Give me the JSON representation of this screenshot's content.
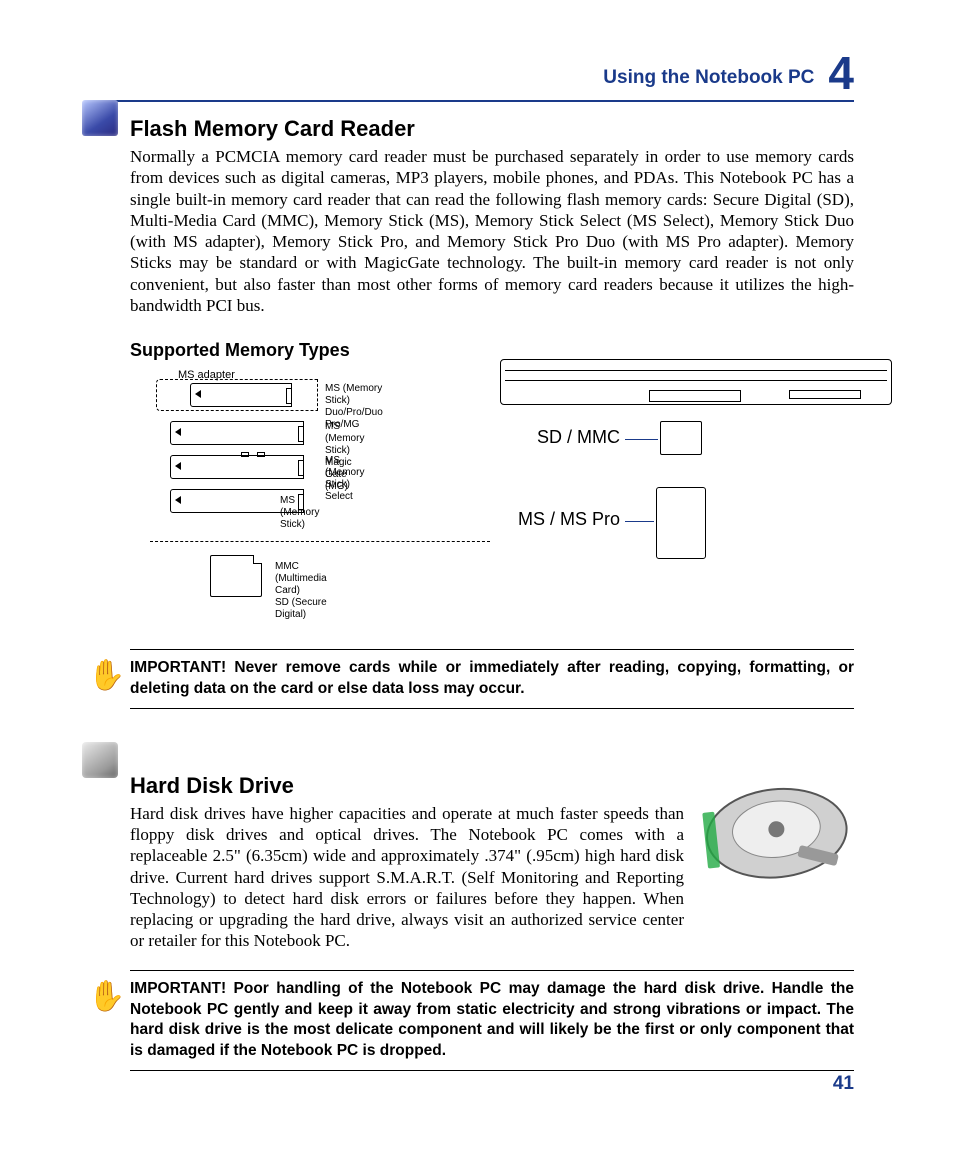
{
  "header": {
    "title": "Using the Notebook PC",
    "chapter": "4"
  },
  "section1": {
    "title": "Flash Memory Card Reader",
    "body": "Normally a PCMCIA memory card reader must be purchased separately in order to use memory cards from devices such as digital cameras, MP3 players, mobile phones, and PDAs. This Notebook PC has a single built-in memory card reader that can read the following flash memory cards: Secure Digital (SD), Multi-Media Card (MMC), Memory Stick (MS), Memory Stick Select (MS Select), Memory Stick Duo (with MS adapter), Memory Stick Pro, and Memory Stick Pro Duo (with MS Pro adapter). Memory Sticks may be standard or with MagicGate technology. The built-in memory card reader is not only convenient, but also faster than most other forms of memory card readers because it utilizes the high-bandwidth PCI bus."
  },
  "subsection": {
    "title": "Supported Memory Types"
  },
  "memtypes": {
    "adapter_label": "MS adapter",
    "rows": [
      {
        "label": "MS (Memory Stick)\nDuo/Pro/Duo Pro/MG"
      },
      {
        "label": "MS (Memory Stick)\nMagic Gate (MG)"
      },
      {
        "label": "MS (Memory Stick)\nSelect"
      },
      {
        "label": "MS (Memory Stick)"
      }
    ],
    "mmc_label": "MMC (Multimedia Card)\nSD (Secure Digital)",
    "sd_label": "SD / MMC",
    "ms_label": "MS / MS Pro"
  },
  "note1": {
    "label": "IMPORTANT!",
    "text": "  Never remove cards while or immediately after reading, copying, formatting, or deleting data on the card or else data loss may occur."
  },
  "section2": {
    "title": "Hard Disk Drive",
    "body": "Hard disk drives have higher capacities and operate at much faster speeds than floppy disk drives and optical drives. The Notebook PC comes with a replaceable 2.5\" (6.35cm) wide and approximately .374\" (.95cm) high hard disk drive. Current hard drives support S.M.A.R.T. (Self Monitoring and Reporting Technology) to detect hard disk errors or failures before they happen. When replacing or upgrading the hard drive, always visit an authorized service center or retailer for this Notebook PC."
  },
  "note2": {
    "label": "IMPORTANT!",
    "text": "  Poor handling of the Notebook PC may damage the hard disk drive. Handle the Notebook PC gently and keep it away from static electricity and strong vibrations or impact. The hard disk drive is the most delicate component and will likely be the first or only component that is damaged if the Notebook PC is dropped."
  },
  "page_number": "41"
}
